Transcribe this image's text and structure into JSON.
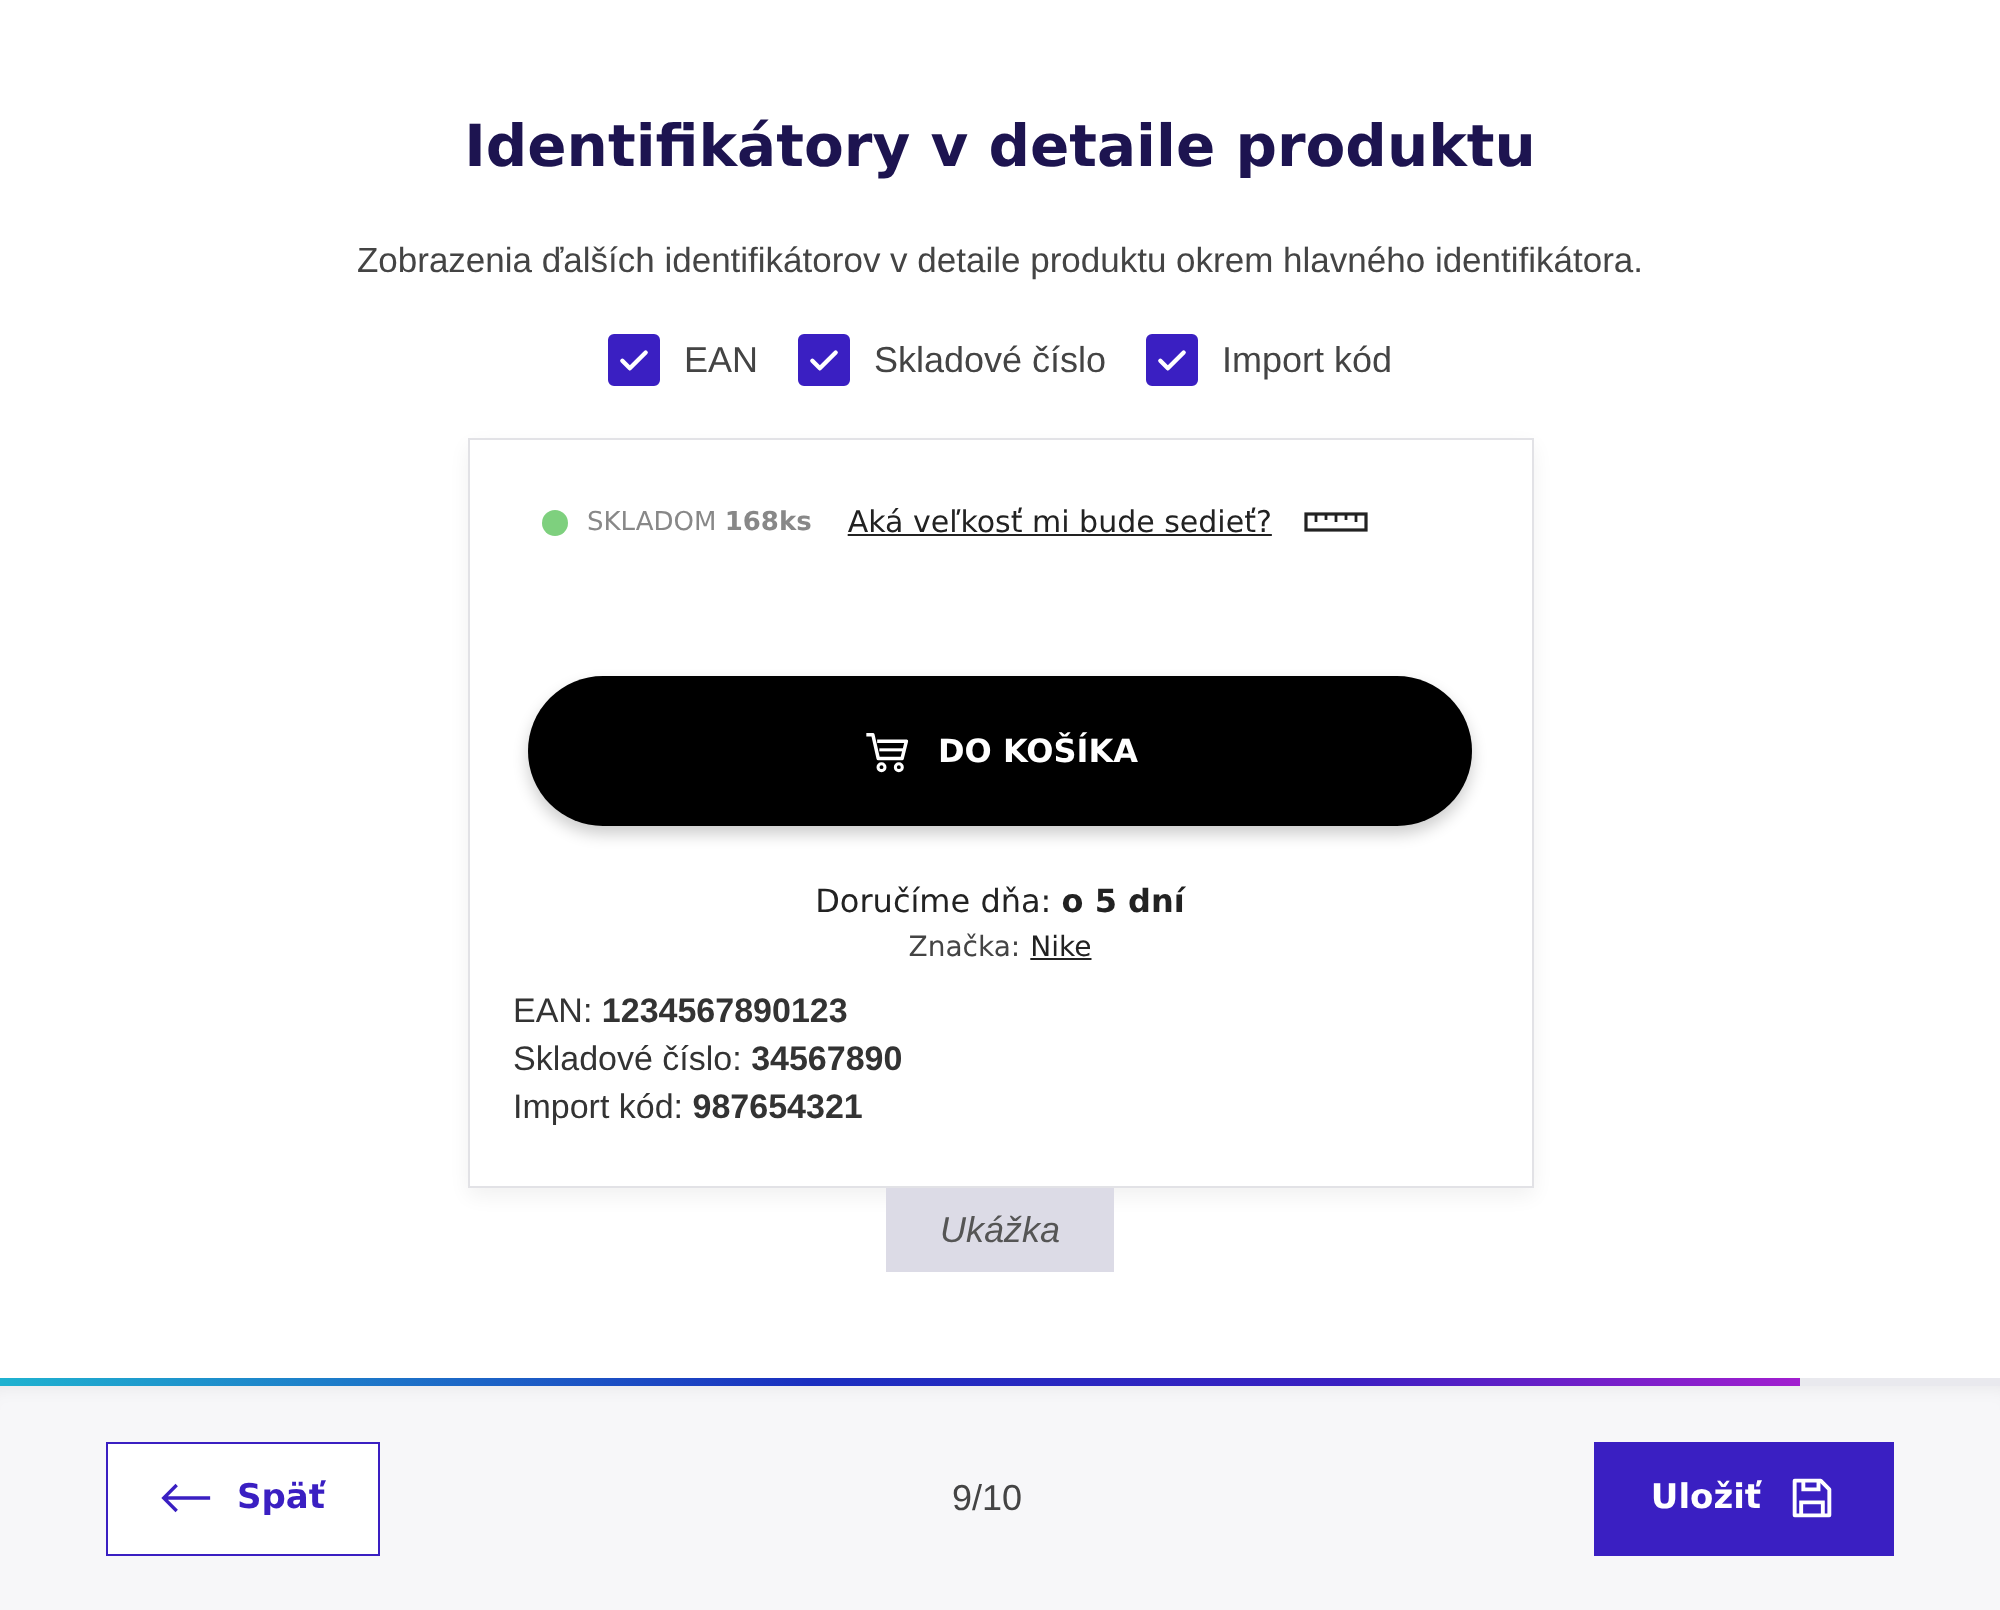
{
  "title": "Identifikátory v detaile produktu",
  "subtitle": "Zobrazenia ďalších identifikátorov v detaile produktu okrem hlavného identifikátora.",
  "options": [
    {
      "label": "EAN",
      "checked": true
    },
    {
      "label": "Skladové číslo",
      "checked": true
    },
    {
      "label": "Import kód",
      "checked": true
    }
  ],
  "preview": {
    "stock": {
      "text": "SKLADOM **168ks**",
      "color": "#7ed07e"
    },
    "size_link": "Aká veľkosť mi bude sedieť?",
    "cart_button": "DO KOŠÍKA",
    "delivery": "Doručíme dňa: **o 5 dní**",
    "brand_label": "Značka:",
    "brand_link": "Nike",
    "identifiers": [
      "EAN: **1234567890123**",
      "Skladové číslo: **34567890**",
      "Import kód: **987654321**"
    ],
    "caption": "Ukážka"
  },
  "progress": {
    "level": 0.9
  },
  "footer": {
    "back": "Späť",
    "page": "9/10",
    "save": "Uložiť"
  }
}
